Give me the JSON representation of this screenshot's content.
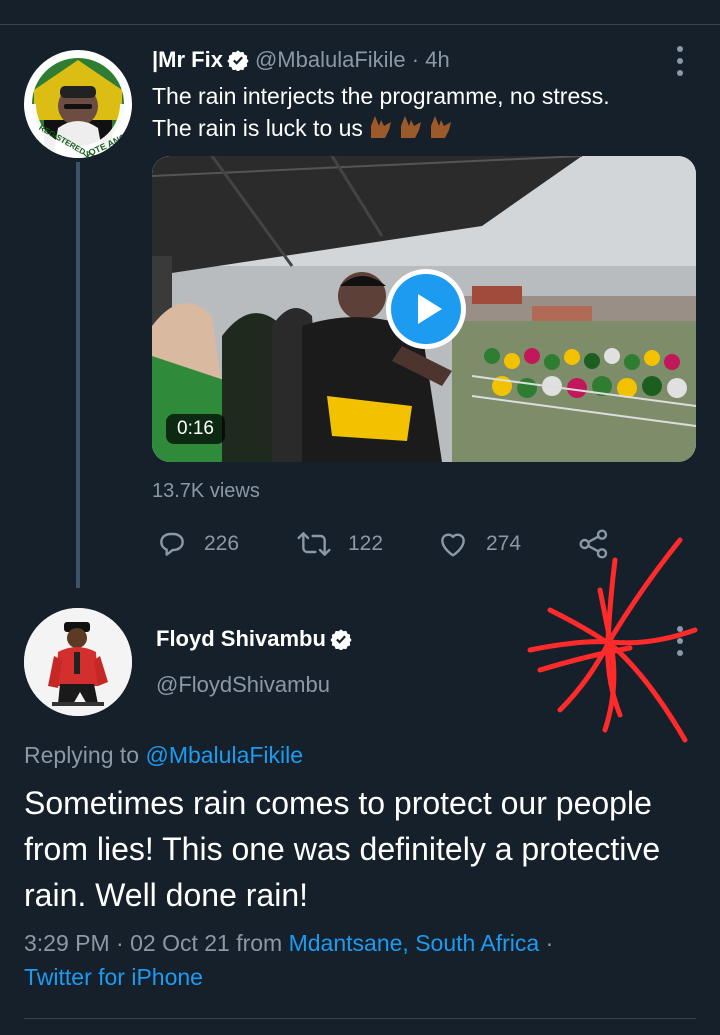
{
  "tweet1": {
    "display_name": "|Mr Fix",
    "handle": "@MbalulaFikile",
    "time": "· 4h",
    "text_line1": "The rain interjects the programme, no stress.",
    "text_line2": "The rain is luck to us",
    "video_duration": "0:16",
    "views": "13.7K views",
    "replies": "226",
    "retweets": "122",
    "likes": "274",
    "avatar_text_top": "REGISTERED TO",
    "avatar_text_bottom": "VOTE ANC"
  },
  "tweet2": {
    "display_name": "Floyd Shivambu",
    "handle": "@FloydShivambu",
    "replying_prefix": "Replying to",
    "replying_to": "@MbalulaFikile",
    "text": "Sometimes rain comes to protect our people from lies! This one was definitely a protective rain. Well done rain!",
    "timestamp": "3:29 PM · 02 Oct 21 from",
    "location": "Mdantsane, South Africa",
    "separator": "·",
    "source": "Twitter for iPhone"
  },
  "colors": {
    "background": "#15202b",
    "link": "#1d9bf0",
    "muted": "#8b98a5",
    "annotation": "#ff2a2a"
  },
  "icons": [
    "verified-badge-icon",
    "more-options-icon",
    "play-icon",
    "reply-icon",
    "retweet-icon",
    "like-icon",
    "share-icon"
  ]
}
